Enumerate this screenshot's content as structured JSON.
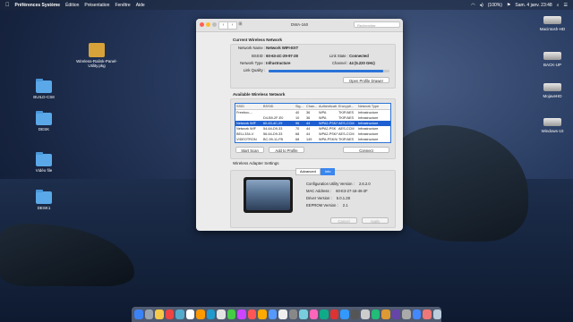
{
  "menubar": {
    "app": "Préférences Système",
    "items": [
      "Édition",
      "Présentation",
      "Fenêtre",
      "Aide"
    ],
    "battery": "(100%)",
    "datetime": "Sam. 4 janv.  23:48"
  },
  "desktop_icons": [
    {
      "label": "Wireless-Ralink-Panel-Utility.pkg",
      "type": "pkg"
    },
    {
      "label": "BUILD-CS8",
      "type": "folder"
    },
    {
      "label": "DESK",
      "type": "folder"
    },
    {
      "label": "Vidéo file",
      "type": "folder"
    },
    {
      "label": "DESK1",
      "type": "folder"
    },
    {
      "label": "Macintosh-HD",
      "type": "disk"
    },
    {
      "label": "BACK-UP",
      "type": "disk"
    },
    {
      "label": "MojaveHD",
      "type": "disk"
    },
    {
      "label": "Windows-10",
      "type": "disk"
    }
  ],
  "window": {
    "title": "DWA-160",
    "search_placeholder": "Rechercher",
    "current": {
      "section_title": "Current Wireless Network",
      "network_name_label": "Network Name :",
      "network_name": "Network WIFI-EXT",
      "bssid_label": "BSSID :",
      "bssid": "60-63-4C-29-97-28",
      "link_state_label": "Link State :",
      "link_state": "Connected",
      "network_type_label": "Network Type :",
      "network_type": "Infrastructure",
      "channel_label": "Channel :",
      "channel": "44 (5.220 GHz)",
      "link_quality_label": "Link Quality :",
      "link_quality": 0.95,
      "open_profile_drawer": "Open Profile Drawer"
    },
    "available": {
      "section_title": "Available Wireless Network",
      "columns": [
        "SSID",
        "BSSID",
        "Sig...",
        "Chan...",
        "Authenticati...",
        "Encrypti...",
        "Network Type"
      ],
      "rows": [
        [
          "Freebox-...",
          "",
          "40",
          "36",
          "WPA",
          "TKIP/AES",
          "Infrastructure"
        ],
        [
          "",
          "D4-B9-2F-E0",
          "10",
          "36",
          "WPA",
          "TKIP/AES",
          "Infrastructure"
        ],
        [
          "Network WIF",
          "60-63-4C-29",
          "96",
          "44",
          "WPA2-PSK/WI",
          "AES-CCM",
          "Infrastructure"
        ],
        [
          "Network WIF",
          "54-64-D9-33",
          "70",
          "44",
          "WPA2-PSK",
          "AES-CCM",
          "Infrastructure"
        ],
        [
          "BELL334-V",
          "56-64-D9-33",
          "68",
          "44",
          "WPA2-PSK/WI",
          "AES-CCM",
          "Infrastructure"
        ],
        [
          "VIDEOTRON",
          "BC-99-11-FB",
          "68",
          "149",
          "WPA-PSK/WP",
          "TKIP/AES",
          "Infrastructure"
        ]
      ],
      "selected_row": 2,
      "start_scan": "Start Scan",
      "add_to_profile": "Add to Profile",
      "connect": "Connect"
    },
    "adapter": {
      "section_title": "Wireless Adapter Settings",
      "tabs": [
        "Advanced",
        "Info"
      ],
      "active_tab": "Info",
      "config_label": "Configuration Utility Version :",
      "config_version": "2.6.2.0",
      "mac_label": "MAC Address :",
      "mac": "60-E3-27-16-46-2F",
      "driver_label": "Driver Version :",
      "driver_version": "5.0.1.28",
      "eeprom_label": "EEPROM Version :",
      "eeprom_version": "2.1",
      "cancel": "Cancel",
      "apply": "Apply"
    }
  },
  "colors": {
    "accent": "#2a73d8",
    "selected_row": "#1d5fd0"
  }
}
